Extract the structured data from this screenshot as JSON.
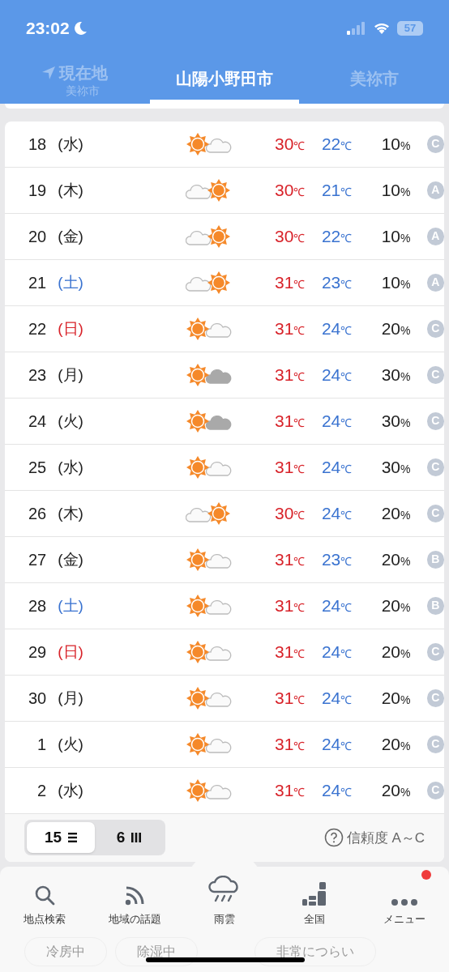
{
  "status_bar": {
    "time": "23:02",
    "battery": "57"
  },
  "tabs": [
    {
      "label": "現在地",
      "sublabel": "美祢市",
      "selected": false,
      "kind": "location"
    },
    {
      "label": "山陽小野田市",
      "selected": true,
      "kind": "city"
    },
    {
      "label": "美祢市",
      "selected": false,
      "kind": "city"
    }
  ],
  "days": [
    {
      "date": "18",
      "weekday": {
        "text": "(水)",
        "kind": "weekday"
      },
      "weather": {
        "kind": "sun_cloud"
      },
      "high": "30",
      "high_unit": "℃",
      "low": "22",
      "low_unit": "℃",
      "precip": "10",
      "precip_unit": "%",
      "reliability": "C"
    },
    {
      "date": "19",
      "weekday": {
        "text": "(木)",
        "kind": "weekday"
      },
      "weather": {
        "kind": "cloud_sun"
      },
      "high": "30",
      "high_unit": "℃",
      "low": "21",
      "low_unit": "℃",
      "precip": "10",
      "precip_unit": "%",
      "reliability": "A"
    },
    {
      "date": "20",
      "weekday": {
        "text": "(金)",
        "kind": "weekday"
      },
      "weather": {
        "kind": "cloud_sun"
      },
      "high": "30",
      "high_unit": "℃",
      "low": "22",
      "low_unit": "℃",
      "precip": "10",
      "precip_unit": "%",
      "reliability": "A"
    },
    {
      "date": "21",
      "weekday": {
        "text": "(土)",
        "kind": "saturday"
      },
      "weather": {
        "kind": "cloud_sun"
      },
      "high": "31",
      "high_unit": "℃",
      "low": "23",
      "low_unit": "℃",
      "precip": "10",
      "precip_unit": "%",
      "reliability": "A"
    },
    {
      "date": "22",
      "weekday": {
        "text": "(日)",
        "kind": "holiday"
      },
      "weather": {
        "kind": "sun_cloud"
      },
      "high": "31",
      "high_unit": "℃",
      "low": "24",
      "low_unit": "℃",
      "precip": "20",
      "precip_unit": "%",
      "reliability": "C"
    },
    {
      "date": "23",
      "weekday": {
        "text": "(月)",
        "kind": "weekday"
      },
      "weather": {
        "kind": "sun_darkcloud"
      },
      "high": "31",
      "high_unit": "℃",
      "low": "24",
      "low_unit": "℃",
      "precip": "30",
      "precip_unit": "%",
      "reliability": "C"
    },
    {
      "date": "24",
      "weekday": {
        "text": "(火)",
        "kind": "weekday"
      },
      "weather": {
        "kind": "sun_darkcloud"
      },
      "high": "31",
      "high_unit": "℃",
      "low": "24",
      "low_unit": "℃",
      "precip": "30",
      "precip_unit": "%",
      "reliability": "C"
    },
    {
      "date": "25",
      "weekday": {
        "text": "(水)",
        "kind": "weekday"
      },
      "weather": {
        "kind": "sun_cloud"
      },
      "high": "31",
      "high_unit": "℃",
      "low": "24",
      "low_unit": "℃",
      "precip": "30",
      "precip_unit": "%",
      "reliability": "C"
    },
    {
      "date": "26",
      "weekday": {
        "text": "(木)",
        "kind": "weekday"
      },
      "weather": {
        "kind": "cloud_sun"
      },
      "high": "30",
      "high_unit": "℃",
      "low": "24",
      "low_unit": "℃",
      "precip": "20",
      "precip_unit": "%",
      "reliability": "C"
    },
    {
      "date": "27",
      "weekday": {
        "text": "(金)",
        "kind": "weekday"
      },
      "weather": {
        "kind": "sun_cloud"
      },
      "high": "31",
      "high_unit": "℃",
      "low": "23",
      "low_unit": "℃",
      "precip": "20",
      "precip_unit": "%",
      "reliability": "B"
    },
    {
      "date": "28",
      "weekday": {
        "text": "(土)",
        "kind": "saturday"
      },
      "weather": {
        "kind": "sun_cloud"
      },
      "high": "31",
      "high_unit": "℃",
      "low": "24",
      "low_unit": "℃",
      "precip": "20",
      "precip_unit": "%",
      "reliability": "B"
    },
    {
      "date": "29",
      "weekday": {
        "text": "(日)",
        "kind": "holiday"
      },
      "weather": {
        "kind": "sun_cloud"
      },
      "high": "31",
      "high_unit": "℃",
      "low": "24",
      "low_unit": "℃",
      "precip": "20",
      "precip_unit": "%",
      "reliability": "C"
    },
    {
      "date": "30",
      "weekday": {
        "text": "(月)",
        "kind": "weekday"
      },
      "weather": {
        "kind": "sun_cloud"
      },
      "high": "31",
      "high_unit": "℃",
      "low": "24",
      "low_unit": "℃",
      "precip": "20",
      "precip_unit": "%",
      "reliability": "C"
    },
    {
      "date": "1",
      "weekday": {
        "text": "(火)",
        "kind": "weekday"
      },
      "weather": {
        "kind": "sun_cloud"
      },
      "high": "31",
      "high_unit": "℃",
      "low": "24",
      "low_unit": "℃",
      "precip": "20",
      "precip_unit": "%",
      "reliability": "C"
    },
    {
      "date": "2",
      "weekday": {
        "text": "(水)",
        "kind": "weekday"
      },
      "weather": {
        "kind": "sun_cloud"
      },
      "high": "31",
      "high_unit": "℃",
      "low": "24",
      "low_unit": "℃",
      "precip": "20",
      "precip_unit": "%",
      "reliability": "C"
    }
  ],
  "view_toggle": [
    {
      "label": "15",
      "kind": "list",
      "selected": true
    },
    {
      "label": "6",
      "kind": "columns",
      "selected": false
    }
  ],
  "reliability_legend": "信頼度 A～C",
  "bottom_nav": [
    {
      "label": "地点検索",
      "kind": "search",
      "badge": false
    },
    {
      "label": "地域の話題",
      "kind": "feed",
      "badge": false
    },
    {
      "label": "雨雲",
      "kind": "rain",
      "badge": false
    },
    {
      "label": "全国",
      "kind": "national",
      "badge": false
    },
    {
      "label": "メニュー",
      "kind": "menu",
      "badge": true
    }
  ],
  "background_chips": [
    "冷房中",
    "除湿中",
    "非常につらい"
  ]
}
